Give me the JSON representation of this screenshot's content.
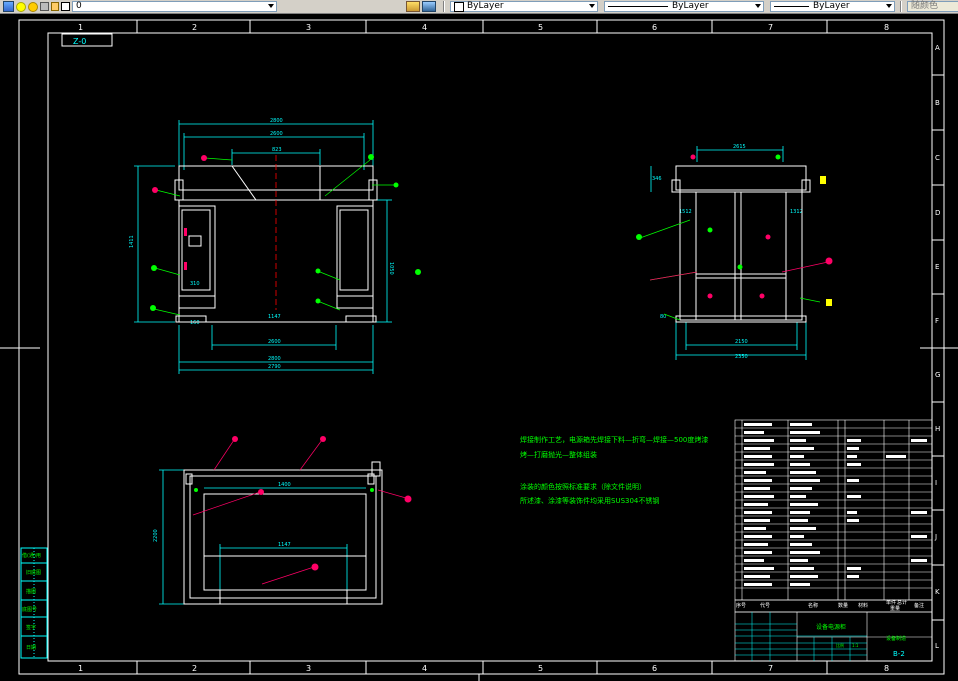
{
  "toolbar": {
    "layer_value": "0",
    "color_value": "ByLayer",
    "linetype_value": "ByLayer",
    "lineweight_value": "ByLayer",
    "plotstyle_value": "随颜色"
  },
  "drawing": {
    "zone_label": "Z-0",
    "column_numbers": [
      "1",
      "2",
      "3",
      "4",
      "5",
      "6",
      "7",
      "8"
    ],
    "row_letters": [
      "A",
      "B",
      "C",
      "D",
      "E",
      "F",
      "G",
      "H",
      "I",
      "J",
      "K",
      "L"
    ],
    "front_view_dims": {
      "overall_width": "2800",
      "inner_width": "2600",
      "top_segment": "823",
      "height": "1411",
      "right_height": "1050",
      "bottom_1": "2600",
      "bottom_2": "2800",
      "bottom_3": "2790",
      "center_mark": "1147",
      "left_small": "310",
      "side_small": "160"
    },
    "side_view_dims": {
      "top": "2615",
      "left_small": "346",
      "height_left": "1512",
      "height_right": "1312",
      "bottom_1": "2150",
      "bottom_2": "2350",
      "foot": "80"
    },
    "plan_view_dims": {
      "width": "1400",
      "inner": "1147",
      "height": "2200"
    },
    "notes": [
      "焊接制作工艺，电源箱先焊接下料—折弯—焊接—500度烤漆",
      "烤—打磨抛光—整体组装",
      "涂装的颜色按照标准要求（除文件说明）",
      "所述漆、涂漆等装饰件均采用SUS304不锈钢"
    ],
    "title_block": {
      "col_headers": [
        "序号",
        "代号",
        "名称",
        "数量",
        "材料",
        "单件",
        "总计",
        "重量",
        "备注"
      ],
      "drawing_title": "设备电源柜",
      "company": "设备制造",
      "drawing_number": "B-2",
      "scale_row": [
        "比例",
        "1:1"
      ]
    },
    "left_revision_labels": [
      "借(通)用",
      "旧底图",
      "描图",
      "底图号",
      "签字",
      "日期"
    ]
  },
  "colors": {
    "background": "#000000",
    "white_line": "#ffffff",
    "cyan_line": "#00ffff",
    "green_line": "#00ff00",
    "magenta": "#ff0066",
    "yellow": "#ffff00",
    "red_center": "#ff0000"
  }
}
